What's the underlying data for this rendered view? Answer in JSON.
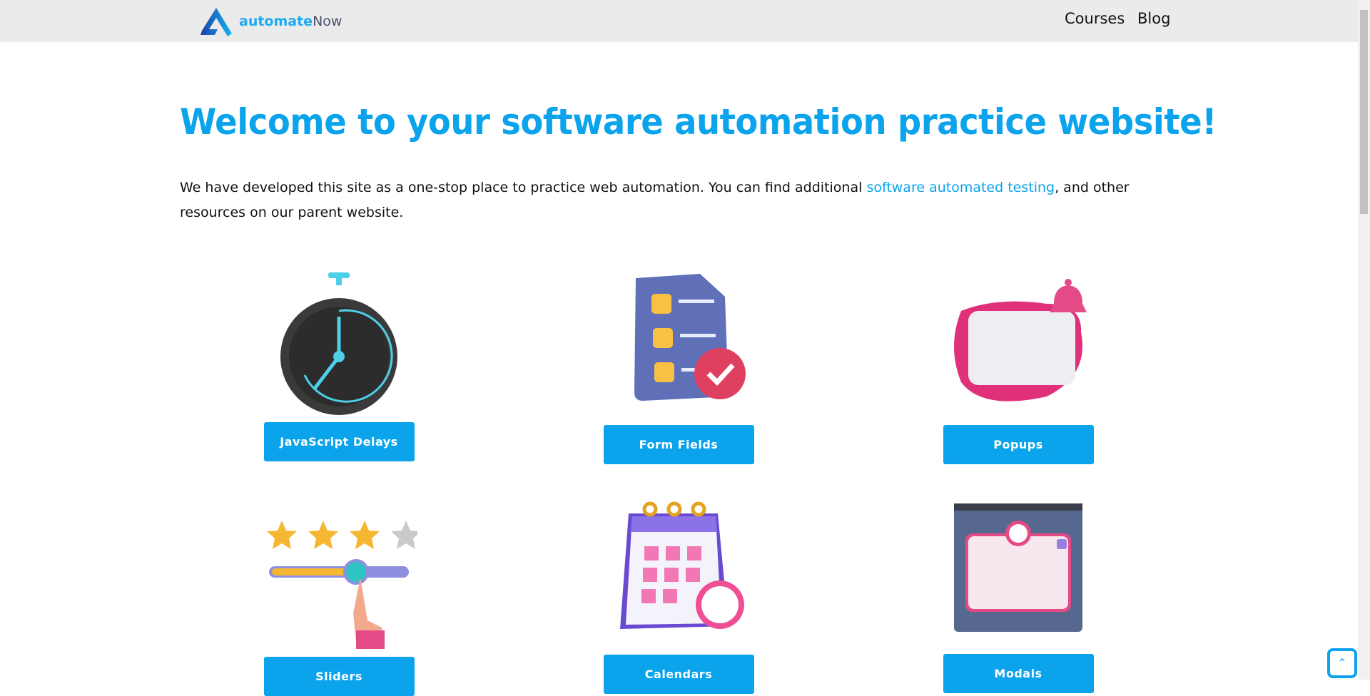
{
  "header": {
    "logo": {
      "bold": "automate",
      "light": "Now"
    },
    "nav": [
      {
        "label": "Courses"
      },
      {
        "label": "Blog"
      }
    ]
  },
  "main": {
    "title": "Welcome to your software automation practice website!",
    "intro_before": "We have developed this site as a one-stop place to practice web automation. You can find additional ",
    "intro_link": "software automated testing",
    "intro_after": ", and other resources on our parent website."
  },
  "cards": [
    {
      "label": "JavaScript Delays",
      "icon": "stopwatch-icon"
    },
    {
      "label": "Form Fields",
      "icon": "form-checklist-icon"
    },
    {
      "label": "Popups",
      "icon": "popup-bell-icon"
    },
    {
      "label": "Sliders",
      "icon": "slider-stars-icon"
    },
    {
      "label": "Calendars",
      "icon": "calendar-icon"
    },
    {
      "label": "Modals",
      "icon": "modal-window-icon"
    }
  ],
  "colors": {
    "accent": "#0ba4ec",
    "header_bg": "#ebebeb"
  },
  "scroll_to_top": {
    "icon": "chevron-up-icon"
  }
}
